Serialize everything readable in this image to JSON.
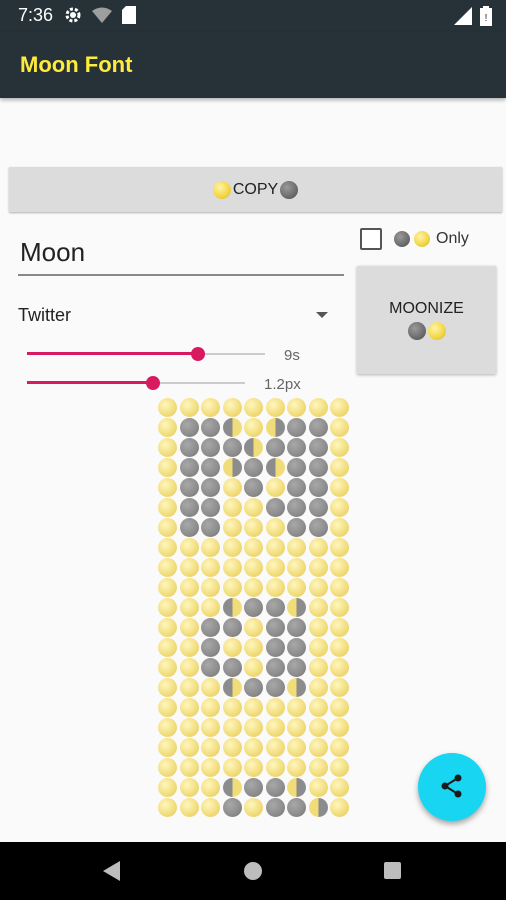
{
  "status_bar": {
    "time": "7:36",
    "icons": [
      "gear-icon",
      "wifi-icon",
      "sd-card-icon",
      "signal-icon",
      "battery-icon"
    ]
  },
  "app_bar": {
    "title": "Moon Font",
    "title_color": "#ffeb3b",
    "background": "#263238"
  },
  "copy_button": {
    "label": "COPY"
  },
  "text_input": {
    "value": "Moon"
  },
  "only_checkbox": {
    "label": "Only",
    "checked": false
  },
  "moonize_button": {
    "label": "MOONIZE"
  },
  "style_dropdown": {
    "selected": "Twitter"
  },
  "speed_slider": {
    "value_label": "9s",
    "fraction": 0.72
  },
  "size_slider": {
    "value_label": "1.2px",
    "fraction": 0.58
  },
  "moon_grid": {
    "rows": [
      "fffffffff",
      "fnnlfrnnf",
      "fnnnlnnnf",
      "fnnrnlnnf",
      "fnnfnfnnf",
      "fnnffnnnf",
      "fnnfffnnf",
      "fffffffff",
      "fffffffff",
      "fffffffff",
      "ffflnnrff",
      "ffnnfnnff",
      "ffnffnnff",
      "ffnnfnnff",
      "ffflnnrff",
      "fffffffff",
      "fffffffff",
      "fffffffff",
      "fffffffff",
      "ffflnnrff",
      "fffnfnnrf"
    ]
  },
  "share_fab": {
    "icon": "share-icon",
    "color": "#18d6f2"
  },
  "colors": {
    "accent": "#d81b60",
    "button_bg": "#dcdcdc"
  }
}
